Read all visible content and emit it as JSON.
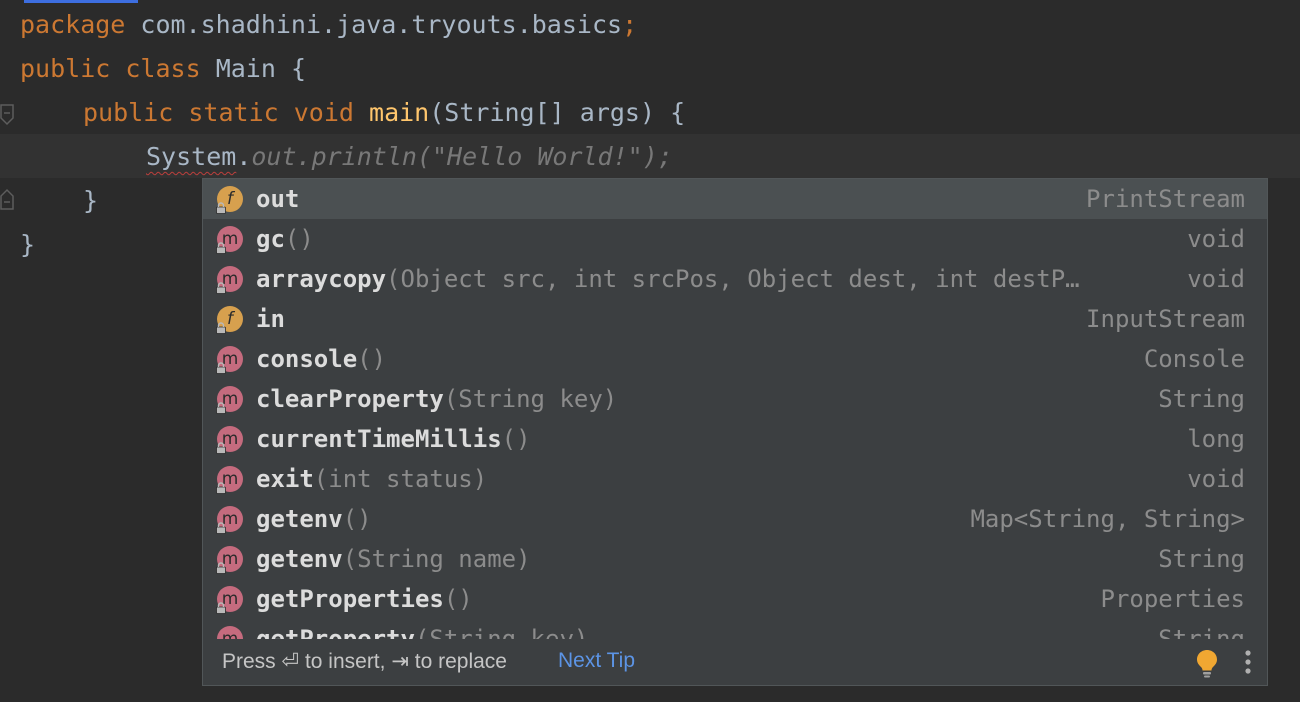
{
  "editor": {
    "line1": {
      "kw": "package",
      "rest": " com.shadhini.java.tryouts.basics",
      "semi": ";"
    },
    "line2": {
      "kw1": "public",
      "kw2": "class",
      "name": "Main",
      "brace": " {"
    },
    "line3": {
      "kw1": "public",
      "kw2": "static",
      "kw3": "void",
      "method": "main",
      "sig": "(String[] args) {"
    },
    "line4": {
      "obj": "System",
      "dot": ".",
      "ghost": "out.println(\"Hello World!\");"
    },
    "line5": {
      "text": "}"
    },
    "line6": {
      "text": "}"
    }
  },
  "completion": {
    "items": [
      {
        "kind": "f",
        "name": "out",
        "params": "",
        "type": "PrintStream",
        "selected": true
      },
      {
        "kind": "m",
        "name": "gc",
        "params": "()",
        "type": "void"
      },
      {
        "kind": "m",
        "name": "arraycopy",
        "params": "(Object src, int srcPos, Object dest, int destP…",
        "type": "void"
      },
      {
        "kind": "f",
        "name": "in",
        "params": "",
        "type": "InputStream"
      },
      {
        "kind": "m",
        "name": "console",
        "params": "()",
        "type": "Console"
      },
      {
        "kind": "m",
        "name": "clearProperty",
        "params": "(String key)",
        "type": "String"
      },
      {
        "kind": "m",
        "name": "currentTimeMillis",
        "params": "()",
        "type": "long"
      },
      {
        "kind": "m",
        "name": "exit",
        "params": "(int status)",
        "type": "void"
      },
      {
        "kind": "m",
        "name": "getenv",
        "params": "()",
        "type": "Map<String, String>"
      },
      {
        "kind": "m",
        "name": "getenv",
        "params": "(String name)",
        "type": "String"
      },
      {
        "kind": "m",
        "name": "getProperties",
        "params": "()",
        "type": "Properties"
      },
      {
        "kind": "m",
        "name": "getProperty",
        "params": "(String key)",
        "type": "String"
      }
    ],
    "footer": {
      "hint": "Press ⏎ to insert, ⇥ to replace",
      "next_tip": "Next Tip"
    }
  },
  "colors": {
    "keyword": "#cc7832",
    "method": "#ffc66d",
    "field": "#9876aa",
    "string": "#6a8759",
    "method_icon": "#c56b7e",
    "field_icon": "#d7a04e",
    "link": "#5c94e5"
  },
  "icons": {
    "method": "method-icon",
    "field": "field-icon",
    "bulb": "lightbulb-icon",
    "more": "more-vertical-icon"
  }
}
